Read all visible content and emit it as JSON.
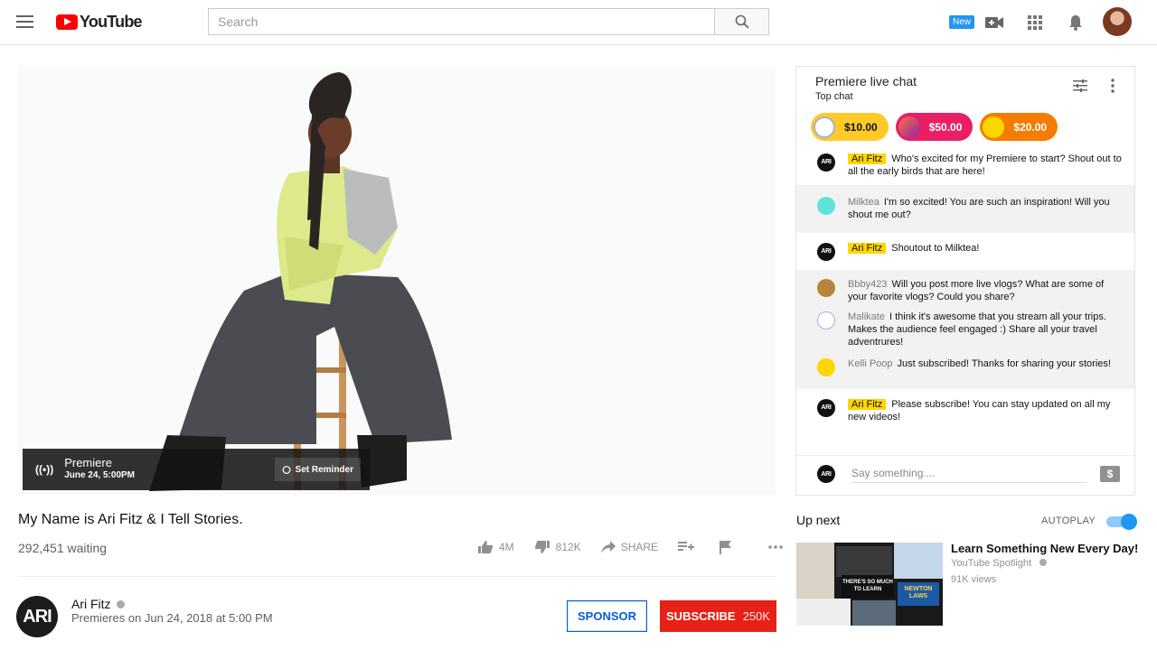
{
  "header": {
    "logo_text": "YouTube",
    "search_placeholder": "Search",
    "new_badge": "New"
  },
  "player": {
    "premiere_label": "Premiere",
    "premiere_date": "June 24, 5:00PM",
    "reminder_label": "Set Reminder"
  },
  "video": {
    "title": "My Name is Ari Fitz & I Tell Stories.",
    "waiting": "292,451 waiting",
    "likes": "4M",
    "dislikes": "812K",
    "share_label": "SHARE"
  },
  "channel": {
    "avatar_text": "ARI",
    "name": "Ari Fitz",
    "premiere_info": "Premieres on Jun 24, 2018 at 5:00 PM",
    "sponsor_label": "SPONSOR",
    "subscribe_label": "SUBSCRIBE",
    "subscriber_count": "250K"
  },
  "chat": {
    "title": "Premiere live chat",
    "mode": "Top chat",
    "tickers": [
      {
        "amount": "$10.00",
        "color": "#ffca28"
      },
      {
        "amount": "$50.00",
        "color": "#e91e63"
      },
      {
        "amount": "$20.00",
        "color": "#f57c00"
      }
    ],
    "messages": [
      {
        "author": "Ari Fitz",
        "text": "Who's excited for my Premiere to start? Shout out to all the early birds that are here!"
      },
      {
        "author": "Milktea",
        "text": "I'm so excited! You are such an inspiration! Will you shout me out?"
      },
      {
        "author": "Ari Fitz",
        "text": "Shoutout to Milktea!"
      },
      {
        "author": "Bbby423",
        "text": "Will you post more live vlogs? What are some of your favorite vlogs? Could you share?"
      },
      {
        "author": "Malikate",
        "text": "I think it's awesome that you stream all your trips. Makes the audience feel engaged  :)  Share all your travel adventrures!"
      },
      {
        "author": "Kelli Poop",
        "text": "Just subscribed! Thanks for sharing your stories!"
      },
      {
        "author": "Ari Fitz",
        "text": "Please subscribe! You can stay updated on all my new videos!"
      }
    ],
    "input_avatar_text": "ARI",
    "input_placeholder": "Say something...."
  },
  "sidebar": {
    "up_next_label": "Up next",
    "autoplay_label": "AUTOPLAY",
    "autoplay_on": true,
    "recommendation": {
      "title": "Learn Something New Every Day!",
      "channel": "YouTube Spotlight",
      "views": "91K views",
      "thumb_text_1": "THERE'S SO MUCH TO LEARN",
      "thumb_text_2": "NEWTON LAWS"
    }
  }
}
